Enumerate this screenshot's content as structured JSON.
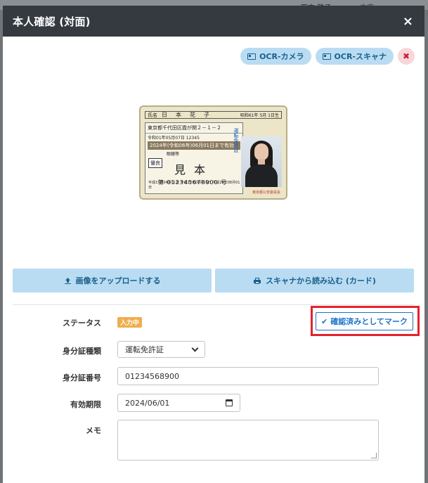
{
  "background": {
    "text_left": "四中 雅子",
    "text_right": "本店"
  },
  "modal": {
    "title": "本人確認 (対面)",
    "close_glyph": "×"
  },
  "top_actions": {
    "ocr_camera": "OCR-カメラ",
    "ocr_scanner": "OCR-スキャナ",
    "clear_glyph": "✖"
  },
  "license": {
    "name_label": "氏名",
    "name": "日本花子",
    "birth": "昭和61年 5月 1日生",
    "address": "東京都千代田区霞が関２－１－２",
    "issue_date": "令和01年05月07日 12345",
    "valid_until": "2024年(令和06年)06月01日まで有効",
    "condition": "眼鏡等",
    "sample": "見本",
    "badge_yuryo": "優良",
    "number": "第 012345678900 号",
    "history": "平成15年04月01日 平成17年06月01日 平成29年08月01日",
    "vertical_text": "運転免許証",
    "seal": "東京都公安委員会"
  },
  "buttons": {
    "upload": "画像をアップロードする",
    "scan": "スキャナから読み込む (カード)",
    "mark_confirmed": "確認済みとしてマーク"
  },
  "form": {
    "status_label": "ステータス",
    "status_value": "入力中",
    "id_type_label": "身分証種類",
    "id_type_value": "運転免許証",
    "id_number_label": "身分証番号",
    "id_number_value": "01234568900",
    "expiry_label": "有効期限",
    "expiry_value": "2024/06/01",
    "memo_label": "メモ",
    "memo_value": ""
  },
  "colors": {
    "header_bg": "#343a40",
    "accent_light": "#b9dcf2",
    "accent": "#1a73c8",
    "highlight": "#e5222c",
    "badge": "#f0ad4e"
  }
}
